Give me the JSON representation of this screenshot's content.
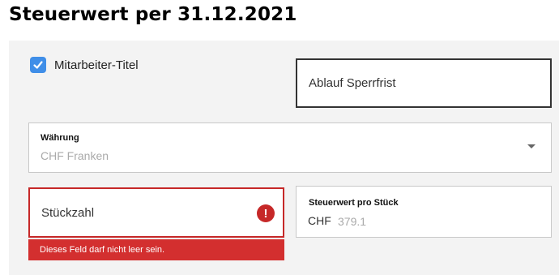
{
  "page": {
    "title": "Steuerwert per 31.12.2021"
  },
  "form": {
    "mitarbeiter": {
      "label": "Mitarbeiter-Titel",
      "checked": true
    },
    "ablauf": {
      "label": "Ablauf Sperrfrist"
    },
    "waehrung": {
      "label": "Währung",
      "value": "CHF Franken"
    },
    "stueckzahl": {
      "label": "Stückzahl",
      "error_icon": "!",
      "error": "Dieses Feld darf nicht leer sein."
    },
    "steuerwert": {
      "label": "Steuerwert pro Stück",
      "currency": "CHF",
      "value": "379.1"
    }
  },
  "colors": {
    "accent": "#3f8ee8",
    "error": "#c62828",
    "panel": "#f3f3f3"
  },
  "icons": {
    "checkbox": "checkmark-icon",
    "select": "chevron-down-icon",
    "error": "error-icon"
  }
}
